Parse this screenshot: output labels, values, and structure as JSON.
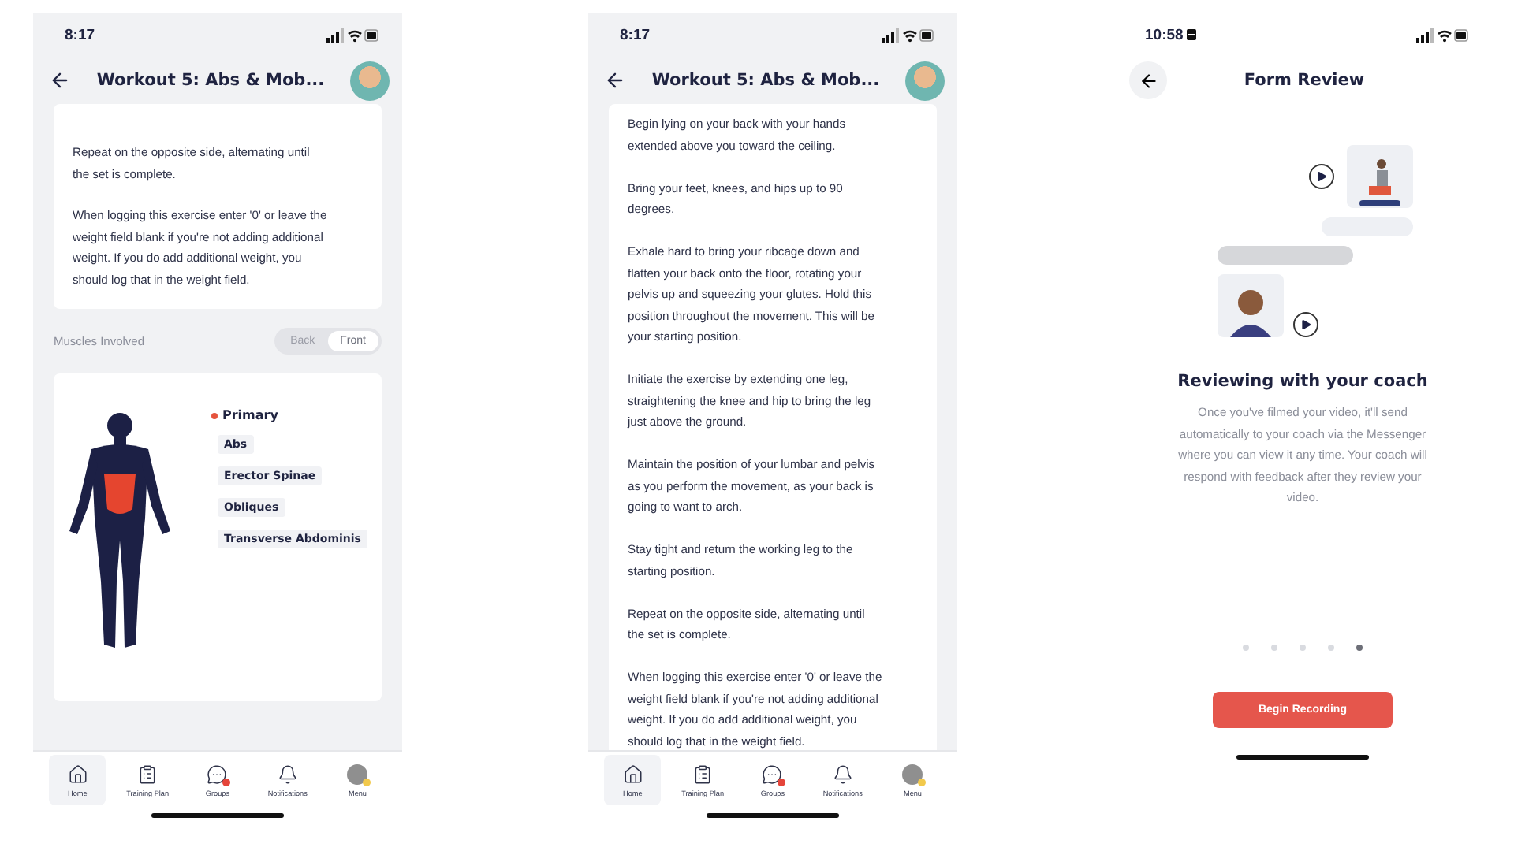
{
  "screen_1": {
    "status_time": "8:17",
    "title": "Workout 5: Abs & Mob...",
    "paragraphs": [
      "Repeat on the opposite side, alternating until the set is complete.",
      "When logging this exercise enter '0' or leave the weight field blank if you're not adding additional weight. If you do add additional weight, you should log that in the weight field."
    ],
    "muscles_heading": "Muscles Involved",
    "view_toggle": [
      {
        "label": "Back",
        "selected": false
      },
      {
        "label": "Front",
        "selected": true
      }
    ],
    "muscle_group": {
      "label": "Primary",
      "color": "#e5533d"
    },
    "muscles": [
      "Abs",
      "Erector Spinae",
      "Obliques",
      "Transverse Abdominis"
    ],
    "tab_bar": [
      {
        "kind": "home",
        "label": "Home",
        "selected": true,
        "badge": false
      },
      {
        "kind": "plan",
        "label": "Training Plan",
        "selected": false,
        "badge": false
      },
      {
        "kind": "chat",
        "label": "Groups",
        "selected": false,
        "badge": true
      },
      {
        "kind": "alerts",
        "label": "Notifications",
        "selected": false,
        "badge": false
      },
      {
        "kind": "profile",
        "label": "Menu",
        "selected": false,
        "badge": true
      }
    ]
  },
  "screen_2": {
    "status_time": "8:17",
    "title": "Workout 5: Abs & Mob...",
    "paragraphs": [
      "Begin lying on your back with your hands extended above you toward the ceiling.",
      "Bring your feet, knees, and hips up to 90 degrees.",
      "Exhale hard to bring your ribcage down and flatten your back onto the floor, rotating your pelvis up and squeezing your glutes. Hold this position throughout the movement. This will be your starting position.",
      "Initiate the exercise by extending one leg, straightening the knee and hip to bring the leg just above the ground.",
      "Maintain the position of your lumbar and pelvis as you perform the movement, as your back is going to want to arch.",
      "Stay tight and return the working leg to the starting position.",
      "Repeat on the opposite side, alternating until the set is complete.",
      "When logging this exercise enter '0' or leave the weight field blank if you're not adding additional weight. If you do add additional weight, you should log that in the weight field."
    ],
    "tab_bar": [
      {
        "kind": "home",
        "label": "Home",
        "selected": true,
        "badge": false
      },
      {
        "kind": "plan",
        "label": "Training Plan",
        "selected": false,
        "badge": false
      },
      {
        "kind": "chat",
        "label": "Groups",
        "selected": false,
        "badge": true
      },
      {
        "kind": "alerts",
        "label": "Notifications",
        "selected": false,
        "badge": false
      },
      {
        "kind": "profile",
        "label": "Menu",
        "selected": false,
        "badge": true
      }
    ]
  },
  "screen_3": {
    "status_time": "10:58",
    "title": "Form Review",
    "heading": "Reviewing with your coach",
    "description": "Once you've filmed your video, it'll send automatically to your coach via the Messenger where you can view it any time. Your coach will respond with feedback after they review your video.",
    "pager": [
      {
        "selected": false
      },
      {
        "selected": false
      },
      {
        "selected": false
      },
      {
        "selected": false
      },
      {
        "selected": true
      }
    ],
    "button": "Begin Recording"
  }
}
